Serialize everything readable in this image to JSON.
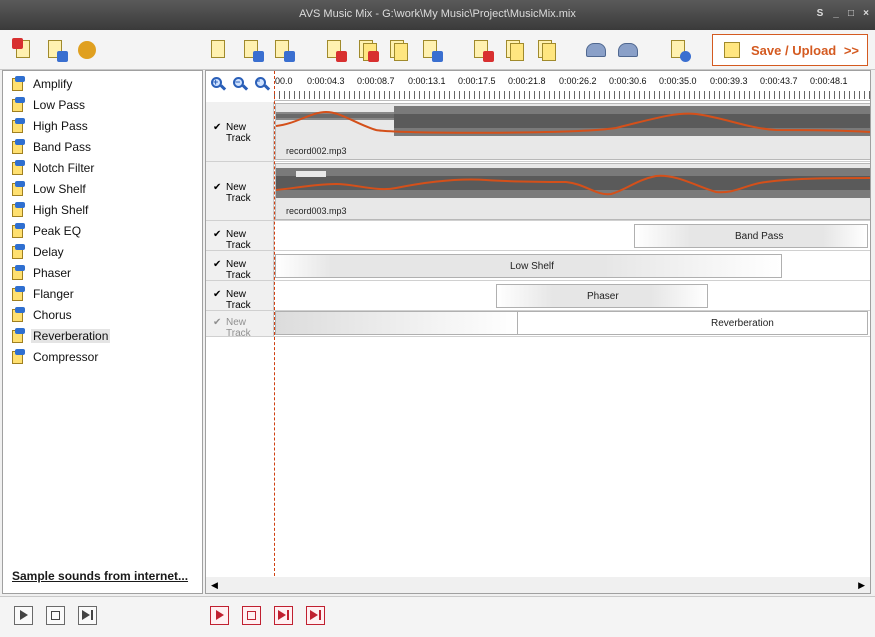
{
  "window": {
    "title": "AVS Music Mix - G:\\work\\My Music\\Project\\MusicMix.mix",
    "controls": [
      "S",
      "_",
      "□",
      "×"
    ]
  },
  "toolbar": {
    "buttons": [
      "remove-icon",
      "import-icon",
      "settings-icon",
      "new-project-icon",
      "save-project-icon",
      "add-track-icon",
      "delete-icon",
      "delete-multiple-icon",
      "copy-icon",
      "add-icon",
      "cut-icon",
      "copy-clip-icon",
      "paste-icon",
      "undo-icon",
      "redo-icon",
      "help-icon"
    ],
    "save_upload_label": "Save / Upload",
    "save_upload_chevron": ">>"
  },
  "effects": {
    "items": [
      "Amplify",
      "Low Pass",
      "High Pass",
      "Band Pass",
      "Notch Filter",
      "Low Shelf",
      "High Shelf",
      "Peak EQ",
      "Delay",
      "Phaser",
      "Flanger",
      "Chorus",
      "Reverberation",
      "Compressor"
    ],
    "selected": "Reverberation",
    "sample_link": "Sample sounds from internet..."
  },
  "ruler": {
    "ticks": [
      "00.0",
      "0:00:04.3",
      "0:00:08.7",
      "0:00:13.1",
      "0:00:17.5",
      "0:00:21.8",
      "0:00:26.2",
      "0:00:30.6",
      "0:00:35.0",
      "0:00:39.3",
      "0:00:43.7",
      "0:00:48.1"
    ]
  },
  "tracks": [
    {
      "name": "New Track",
      "checked": true,
      "clip": "record002.mp3"
    },
    {
      "name": "New Track",
      "checked": true,
      "clip": "record003.mp3"
    },
    {
      "name": "New Track",
      "checked": true,
      "effect": "Band Pass"
    },
    {
      "name": "New Track",
      "checked": true,
      "effect": "Low Shelf"
    },
    {
      "name": "New Track",
      "checked": true,
      "effect": "Phaser"
    },
    {
      "name": "New Track",
      "checked": true,
      "effect": "Reverberation",
      "dimmed": true
    }
  ],
  "checkmark": "✔",
  "scroll": {
    "left": "◀",
    "right": "▶"
  },
  "colors": {
    "accent": "#d45a20",
    "envelope": "#d4501a",
    "wave": "#6e6e6e",
    "transport_red": "#c02030"
  }
}
